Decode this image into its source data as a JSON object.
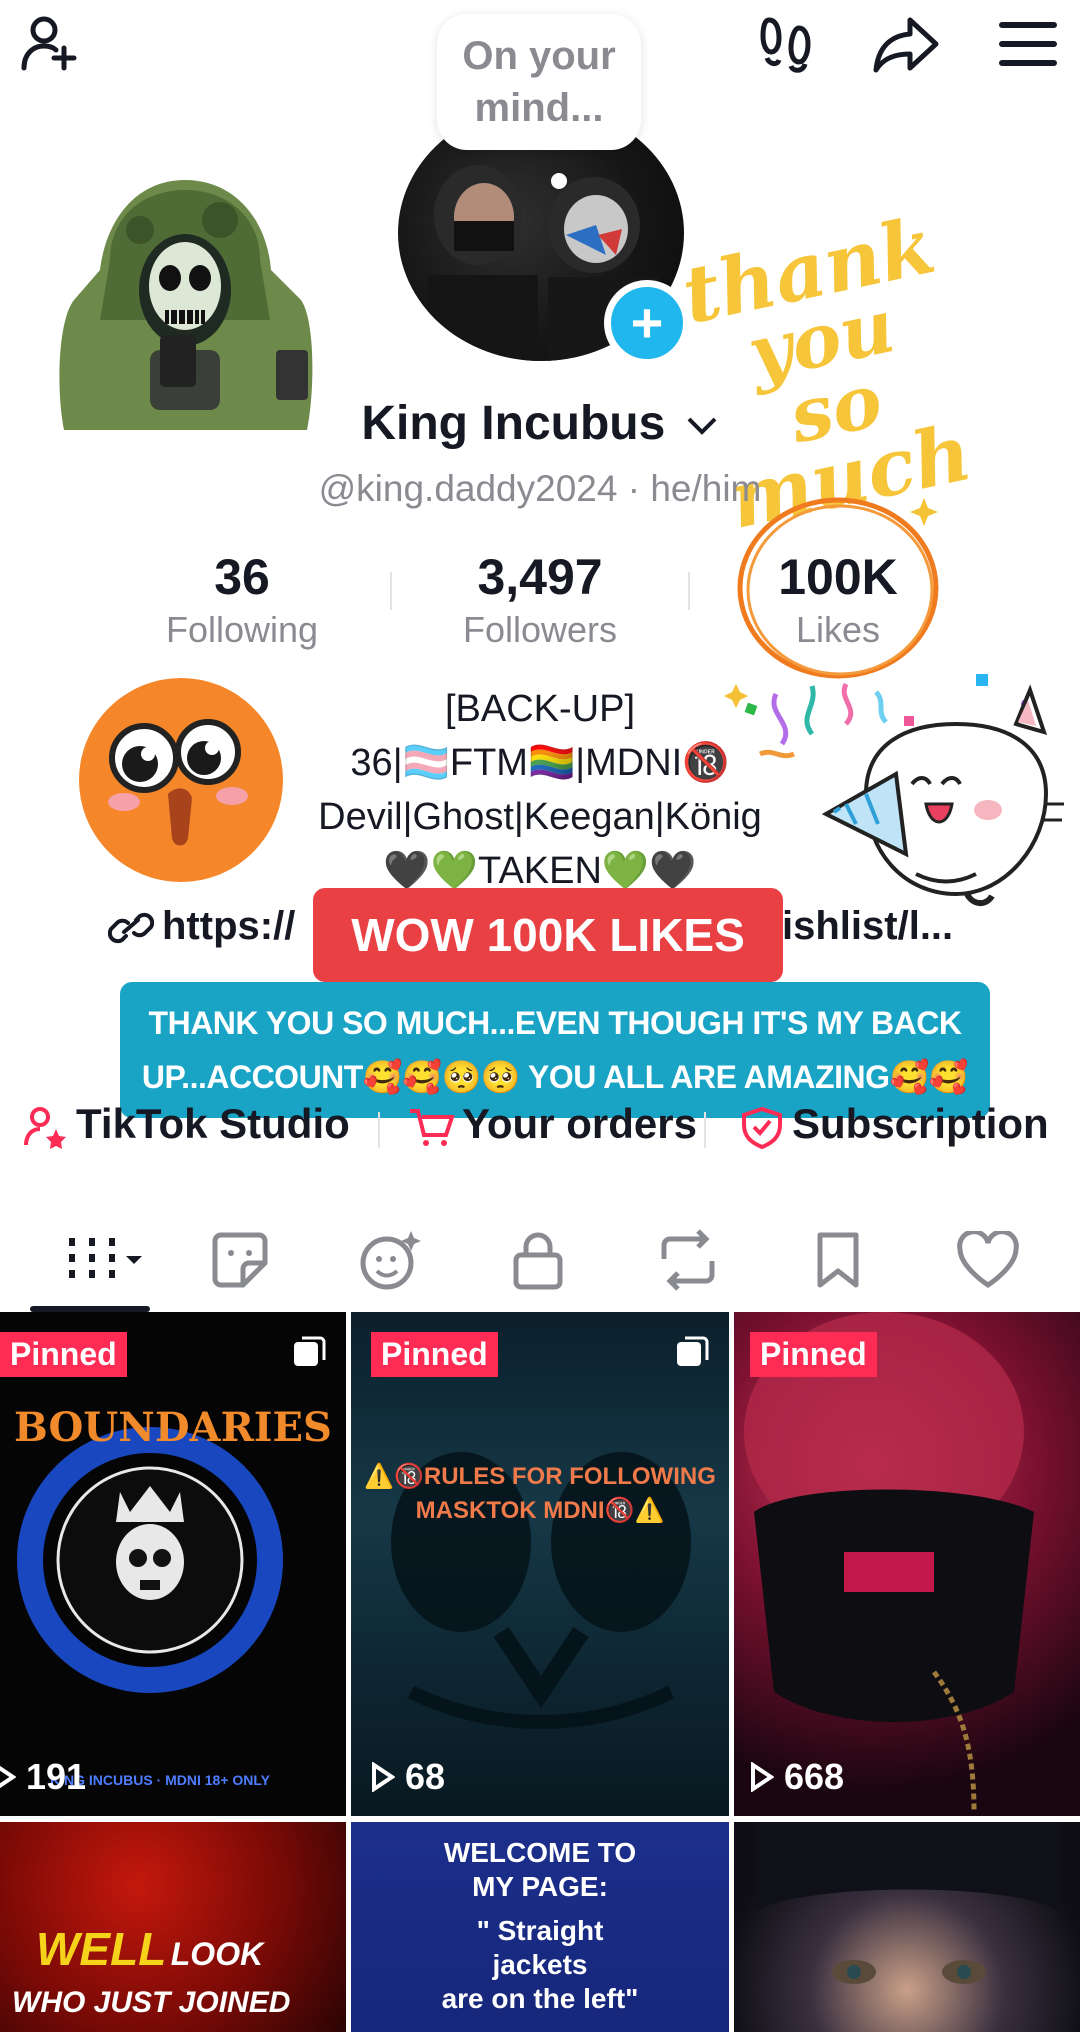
{
  "header": {
    "add_friend_icon": "person-plus-icon",
    "footprint_icon": "footprints-icon",
    "share_icon": "share-arrow-icon",
    "menu_icon": "hamburger-icon"
  },
  "bubble": {
    "text_line1": "On your",
    "text_line2": "mind..."
  },
  "profile": {
    "name": "King Incubus",
    "handle": "@king.daddy2024 · he/him"
  },
  "stats": [
    {
      "value": "36",
      "label": "Following"
    },
    {
      "value": "3,497",
      "label": "Followers"
    },
    {
      "value": "100K",
      "label": "Likes"
    }
  ],
  "bio": {
    "line1": "[BACK-UP]",
    "line2": "36|🏳️‍⚧️FTM🏳️‍🌈|MDNI🔞",
    "line3": "Devil|Ghost|Keegan|König",
    "line4": "🖤💚TAKEN💚🖤"
  },
  "link": {
    "left": "https://",
    "right": "ishlist/l..."
  },
  "overlay": {
    "wow": "WOW 100K LIKES",
    "thanks_line1": "THANK YOU SO MUCH...EVEN THOUGH IT'S MY BACK",
    "thanks_line2": "UP...ACCOUNT🥰🥰🥺🥺 YOU ALL ARE AMAZING🥰🥰"
  },
  "sticker_text": {
    "line1": "thank",
    "line2": "you so",
    "line3": "much"
  },
  "shortcuts": [
    {
      "label": "TikTok Studio"
    },
    {
      "label": "Your orders"
    },
    {
      "label": "Subscription"
    }
  ],
  "videos": [
    {
      "pinned": "Pinned",
      "views": "191",
      "title": "BOUNDARIES",
      "ring_text": "KING INCUBUS · MDNI 18+ ONLY"
    },
    {
      "pinned": "Pinned",
      "views": "68",
      "title_line1": "⚠️🔞RULES FOR FOLLOWING",
      "title_line2": "MASKTOK MDNI🔞⚠️"
    },
    {
      "pinned": "Pinned",
      "views": "668"
    },
    {
      "caption1": "WELL",
      "caption1b": "LOOK",
      "caption2": "WHO JUST JOINED"
    },
    {
      "line1": "WELCOME TO",
      "line2": "MY PAGE:",
      "line3": "\" Straight",
      "line4": "jackets",
      "line5": "are on the left\""
    },
    {}
  ],
  "colors": {
    "accent": "#fe2c55",
    "blue": "#20b6ee",
    "wow": "#e94044",
    "thanks": "#19a4c6"
  }
}
